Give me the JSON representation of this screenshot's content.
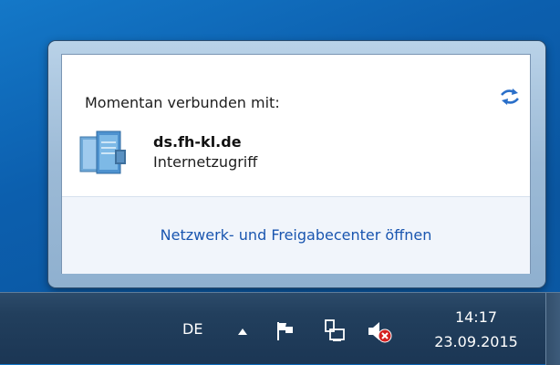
{
  "popup": {
    "header": "Momentan verbunden mit:",
    "network": {
      "name": "ds.fh-kl.de",
      "status": "Internetzugriff",
      "icon": "domain-network-icon"
    },
    "refresh_icon": "refresh-icon",
    "footer_link": "Netzwerk- und Freigabecenter öffnen"
  },
  "taskbar": {
    "language": "DE",
    "tray_icons": [
      "show-hidden-icons-arrow",
      "action-center-flag-icon",
      "network-icon",
      "volume-muted-icon"
    ],
    "clock": {
      "time": "14:17",
      "date": "23.09.2015"
    }
  },
  "colors": {
    "desktop": "#0c5fae",
    "link": "#1a56b0",
    "taskbar": "#223f5d",
    "muted_badge": "#d32020"
  }
}
